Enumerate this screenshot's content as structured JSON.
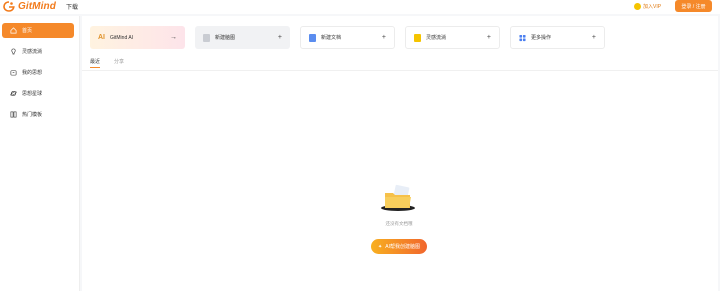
{
  "header": {
    "brand": "GitMind",
    "nav_download": "下载",
    "vip_label": "加入VIP",
    "login_label": "登录 / 注册"
  },
  "sidebar": {
    "items": [
      {
        "label": "首页",
        "icon": "home-icon"
      },
      {
        "label": "灵感流淌",
        "icon": "lightbulb-icon"
      },
      {
        "label": "我的思想",
        "icon": "folder-icon"
      },
      {
        "label": "思想星球",
        "icon": "planet-icon"
      },
      {
        "label": "热门模板",
        "icon": "template-icon"
      }
    ]
  },
  "cards": [
    {
      "label": "GitMind AI",
      "badge": "AI",
      "action": "→"
    },
    {
      "label": "新建脑图",
      "action": "+"
    },
    {
      "label": "新建文档",
      "action": "+"
    },
    {
      "label": "灵感流淌",
      "action": "+"
    },
    {
      "label": "更多操作",
      "action": "+"
    }
  ],
  "tabs": [
    {
      "label": "最近",
      "active": true
    },
    {
      "label": "分享",
      "active": false
    }
  ],
  "empty_state": {
    "message": "还没有文档哦",
    "button_label": "AI帮我创建脑图"
  },
  "colors": {
    "accent": "#f5892a",
    "brand": "#f27a1a"
  }
}
